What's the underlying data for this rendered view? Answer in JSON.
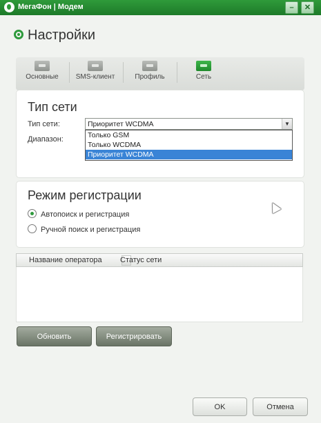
{
  "window": {
    "title": "МегаФон | Модем",
    "min_label": "–",
    "close_label": "✕"
  },
  "page": {
    "title": "Настройки",
    "icon": "gear-icon"
  },
  "tabs": [
    {
      "label": "Основные",
      "icon": "key-icon",
      "active": false
    },
    {
      "label": "SMS-клиент",
      "icon": "key-icon",
      "active": false
    },
    {
      "label": "Профиль",
      "icon": "key-icon",
      "active": false
    },
    {
      "label": "Сеть",
      "icon": "network-icon",
      "active": true
    }
  ],
  "network_type": {
    "heading": "Тип сети",
    "type_label": "Тип сети:",
    "range_label": "Диапазон:",
    "selected": "Приоритет WCDMA",
    "options": [
      "Только GSM",
      "Только WCDMA",
      "Приоритет WCDMA"
    ]
  },
  "registration": {
    "heading": "Режим регистрации",
    "options": [
      {
        "label": "Автопоиск и регистрация",
        "checked": true
      },
      {
        "label": "Ручной поиск и регистрация",
        "checked": false
      }
    ]
  },
  "operators_table": {
    "columns": [
      "Название оператора",
      "Статус сети"
    ]
  },
  "buttons": {
    "refresh": "Обновить",
    "register": "Регистрировать",
    "ok": "OK",
    "cancel": "Отмена"
  },
  "colors": {
    "accent": "#2e9a3c",
    "selection": "#3a84d6"
  }
}
